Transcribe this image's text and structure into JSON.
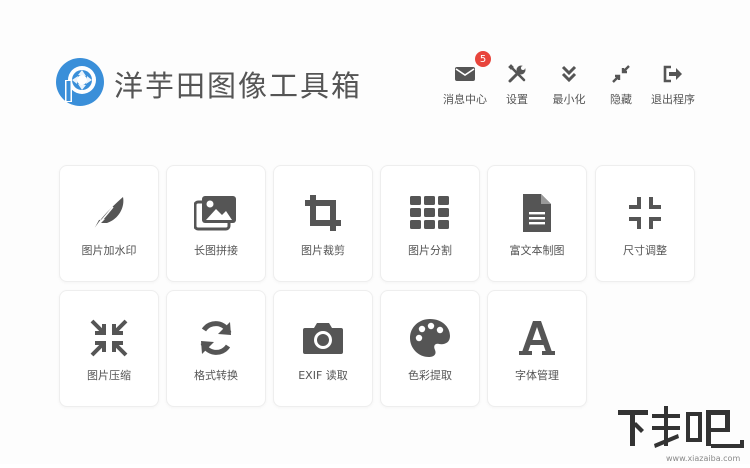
{
  "app": {
    "title": "洋芋田图像工具箱",
    "accent_color": "#3a8fd9",
    "icon_color": "#555555"
  },
  "toolbar": {
    "messages": {
      "label": "消息中心",
      "icon": "envelope-icon",
      "badge": "5"
    },
    "settings": {
      "label": "设置",
      "icon": "wrench-screwdriver-icon"
    },
    "minimize": {
      "label": "最小化",
      "icon": "double-chevron-down-icon"
    },
    "hide": {
      "label": "隐藏",
      "icon": "compress-arrows-icon"
    },
    "exit": {
      "label": "退出程序",
      "icon": "sign-out-icon"
    }
  },
  "tools": [
    {
      "label": "图片加水印",
      "icon": "feather-icon"
    },
    {
      "label": "长图拼接",
      "icon": "images-icon"
    },
    {
      "label": "图片裁剪",
      "icon": "crop-icon"
    },
    {
      "label": "图片分割",
      "icon": "grid-icon"
    },
    {
      "label": "富文本制图",
      "icon": "document-icon"
    },
    {
      "label": "尺寸调整",
      "icon": "compress-corners-icon"
    },
    {
      "label": "图片压缩",
      "icon": "compress-arrows-icon"
    },
    {
      "label": "格式转换",
      "icon": "refresh-icon"
    },
    {
      "label": "EXIF 读取",
      "icon": "camera-icon"
    },
    {
      "label": "色彩提取",
      "icon": "palette-icon"
    },
    {
      "label": "字体管理",
      "icon": "font-icon"
    }
  ],
  "watermark": {
    "text": "下载吧",
    "url": "www.xiazaiba.com"
  }
}
